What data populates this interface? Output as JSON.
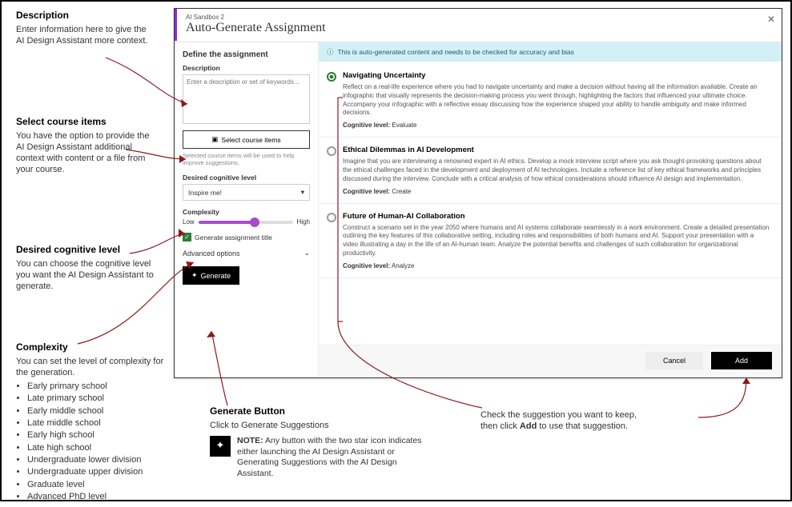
{
  "annotations": {
    "description": {
      "h": "Description",
      "p": "Enter information here to give the AI Design Assistant more context."
    },
    "select_items": {
      "h": "Select course items",
      "p": "You have the option to provide the AI Design Assistant additional context with content or a file from your course."
    },
    "cog_level": {
      "h": "Desired cognitive level",
      "p": "You can choose the cognitive level you want the AI Design Assistant to generate."
    },
    "complexity": {
      "h": "Complexity",
      "p": "You can set the level of complexity for the generation.",
      "levels": [
        "Early primary school",
        "Late primary school",
        "Early middle school",
        "Late middle school",
        "Early high school",
        "Late high school",
        "Undergraduate lower division",
        "Undergraduate upper division",
        "Graduate level",
        "Advanced PhD level"
      ]
    },
    "generate": {
      "h": "Generate Button",
      "p": "Click to Generate Suggestions",
      "note_label": "NOTE:",
      "note": "Any button with the two star icon indicates either launching the AI Design Assistant or Generating Suggestions with the AI Design Assistant."
    },
    "check": {
      "p1": "Check the suggestion you want to keep,",
      "p2_a": "then click ",
      "p2_b": "Add",
      "p2_c": " to use that suggestion."
    }
  },
  "app": {
    "breadcrumb": "AI Sandbox 2",
    "title": "Auto-Generate Assignment",
    "left": {
      "define": "Define the assignment",
      "desc_label": "Description",
      "desc_placeholder": "Enter a description or set of keywords...",
      "select_btn": "Select course items",
      "select_help": "Selected course items will be used to help improve suggestions.",
      "cog_label": "Desired cognitive level",
      "cog_value": "Inspire me!",
      "complexity_label": "Complexity",
      "low": "Low",
      "high": "High",
      "gen_title_chk": "Generate assignment title",
      "adv": "Advanced options",
      "generate_btn": "Generate"
    },
    "info": "This is auto-generated content and needs to be checked for accuracy and bias",
    "results": [
      {
        "selected": true,
        "title": "Navigating Uncertainty",
        "desc": "Reflect on a real-life experience where you had to navigate uncertainty and make a decision without having all the information available. Create an infographic that visually represents the decision-making process you went through, highlighting the factors that influenced your ultimate choice. Accompany your infographic with a reflective essay discussing how the experience shaped your ability to handle ambiguity and make informed decisions.",
        "cog_label": "Cognitive level:",
        "cog_value": "Evaluate"
      },
      {
        "selected": false,
        "title": "Ethical Dilemmas in AI Development",
        "desc": "Imagine that you are interviewing a renowned expert in AI ethics. Develop a mock interview script where you ask thought-provoking questions about the ethical challenges faced in the development and deployment of AI technologies. Include a reference list of key ethical frameworks and principles discussed during the interview. Conclude with a critical analysis of how ethical considerations should influence AI design and implementation.",
        "cog_label": "Cognitive level:",
        "cog_value": "Create"
      },
      {
        "selected": false,
        "title": "Future of Human-AI Collaboration",
        "desc": "Construct a scenario set in the year 2050 where humans and AI systems collaborate seamlessly in a work environment. Create a detailed presentation outlining the key features of this collaborative setting, including roles and responsibilities of both humans and AI. Support your presentation with a video illustrating a day in the life of an AI-human team. Analyze the potential benefits and challenges of such collaboration for organizational productivity.",
        "cog_label": "Cognitive level:",
        "cog_value": "Analyze"
      }
    ],
    "cancel": "Cancel",
    "add": "Add"
  }
}
